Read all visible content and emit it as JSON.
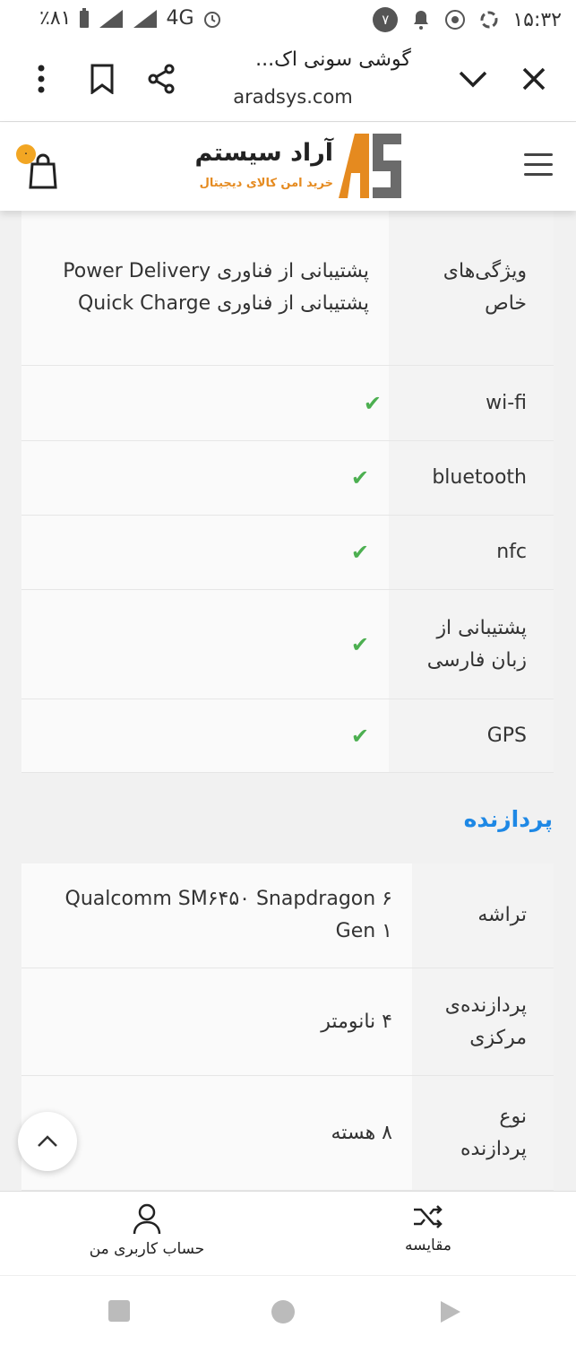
{
  "status_bar": {
    "battery": "٪۸۱",
    "network": "4G",
    "notification_count": "۷",
    "time": "۱۵:۳۲"
  },
  "browser": {
    "title": "گوشی سونی اک...",
    "url": "aradsys.com"
  },
  "header": {
    "logo_name": "آراد سیستم",
    "logo_tagline": "خرید امن کالای دیجیتال",
    "cart_count": "۰"
  },
  "specs_top": [
    {
      "label": "ویژگی‌های خاص",
      "value_lines": [
        "پشتیبانی از فناوری Power Delivery",
        "پشتیبانی از فناوری Quick Charge"
      ],
      "check": false
    },
    {
      "label": "wi-fi",
      "check": true
    },
    {
      "label": "bluetooth",
      "check": true
    },
    {
      "label": "nfc",
      "check": true
    },
    {
      "label": "پشتیبانی از زبان فارسی",
      "check": true
    },
    {
      "label": "GPS",
      "check": true
    }
  ],
  "section_processor": {
    "title": "پردازنده",
    "rows": [
      {
        "label": "تراشه",
        "value": "Qualcomm SM۶۴۵۰ Snapdragon ۶ Gen ۱"
      },
      {
        "label": "پردازنده‌ی مرکزی",
        "value": "۴ نانومتر"
      },
      {
        "label": "نوع پردازنده",
        "value": "۸ هسته"
      }
    ]
  },
  "bottom_nav": {
    "account_label": "حساب کاربری من",
    "compare_label": "مقایسه"
  },
  "colors": {
    "accent": "#1e88e5",
    "check": "#4caf50",
    "logo_orange": "#e58a1f"
  }
}
